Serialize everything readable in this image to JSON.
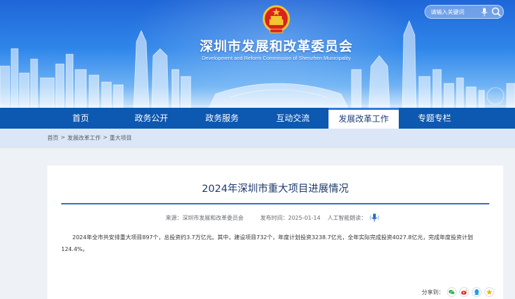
{
  "header": {
    "site_title": "深圳市发展和改革委员会",
    "site_subtitle": "Development and Reform Commission of Shenzhen Municipality",
    "search": {
      "placeholder": "请输入关键词"
    }
  },
  "nav": {
    "items": [
      {
        "label": "首页"
      },
      {
        "label": "政务公开"
      },
      {
        "label": "政务服务"
      },
      {
        "label": "互动交流"
      },
      {
        "label": "发展改革工作",
        "active": true
      },
      {
        "label": "专题专栏"
      }
    ]
  },
  "breadcrumb": {
    "items": [
      "首页",
      "发展改革工作",
      "重大项目"
    ],
    "separator": ">"
  },
  "article": {
    "title": "2024年深圳市重大项目进展情况",
    "source_label": "来源：深圳市发展和改革委员会",
    "date_label": "发布时间：2025-01-14",
    "reader_label": "人工智能朗读：",
    "body": "2024年全市共安排重大项目897个，总投资约3.7万亿元。其中，建设项目732个，年度计划投资3238.7亿元，全年实际完成投资4027.8亿元，完成年度投资计划124.4%。"
  },
  "share": {
    "label": "分享到：",
    "buttons": [
      "wechat-icon",
      "weibo-icon",
      "qq-icon",
      "favorite-icon"
    ]
  },
  "colors": {
    "nav_bg": "#0d58b0",
    "title_color": "#1e3a6b",
    "rule_color": "#2d6fca",
    "crumb_bg": "#dbe7f6",
    "page_bg": "#eef1f5"
  }
}
